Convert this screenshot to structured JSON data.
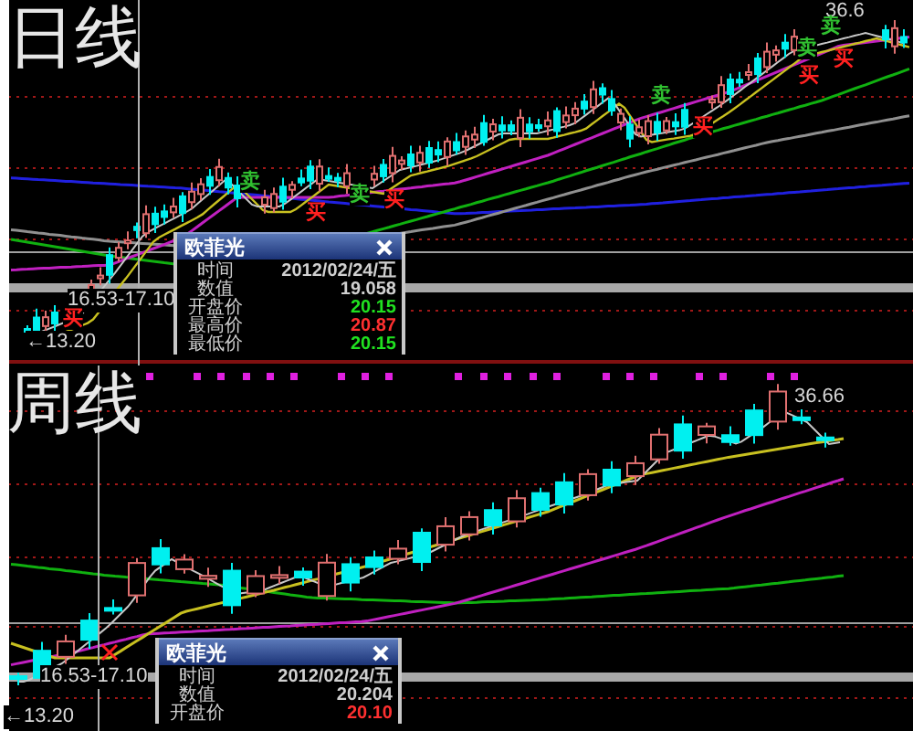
{
  "panels": [
    {
      "title": "日线",
      "annotations": [
        {
          "kind": "range",
          "text": "16.53-17.10"
        },
        {
          "kind": "low",
          "text": "←13.20"
        },
        {
          "kind": "high",
          "text": "36.6"
        }
      ],
      "signals": [
        {
          "kind": "sell",
          "label": "卖"
        },
        {
          "kind": "buy",
          "label": "买"
        },
        {
          "kind": "sell",
          "label": "卖"
        },
        {
          "kind": "buy",
          "label": "买"
        },
        {
          "kind": "buy",
          "label": "买"
        },
        {
          "kind": "sell",
          "label": "卖"
        },
        {
          "kind": "buy",
          "label": "买"
        },
        {
          "kind": "sell",
          "label": "卖"
        },
        {
          "kind": "buy",
          "label": "买"
        },
        {
          "kind": "sell",
          "label": "卖"
        },
        {
          "kind": "buy",
          "label": "买"
        }
      ],
      "popup": {
        "title": "欧菲光",
        "rows": [
          {
            "label": "时间",
            "value": "2012/02/24/五",
            "color": "#d0d0d0"
          },
          {
            "label": "数值",
            "value": "19.058",
            "color": "#d0d0d0"
          },
          {
            "label": "开盘价",
            "value": "20.15",
            "color": "#20e020"
          },
          {
            "label": "最高价",
            "value": "20.87",
            "color": "#ff3030"
          },
          {
            "label": "最低价",
            "value": "20.15",
            "color": "#20e020"
          }
        ]
      }
    },
    {
      "title": "周线",
      "annotations": [
        {
          "kind": "high",
          "text": "36.66"
        },
        {
          "kind": "range",
          "text": "16.53-17.10"
        },
        {
          "kind": "low",
          "text": "←13.20"
        }
      ],
      "popup": {
        "title": "欧菲光",
        "rows": [
          {
            "label": "时间",
            "value": "2012/02/24/五",
            "color": "#d0d0d0"
          },
          {
            "label": "数值",
            "value": "20.204",
            "color": "#d0d0d0"
          },
          {
            "label": "开盘价",
            "value": "20.10",
            "color": "#ff3030"
          }
        ]
      }
    }
  ]
}
